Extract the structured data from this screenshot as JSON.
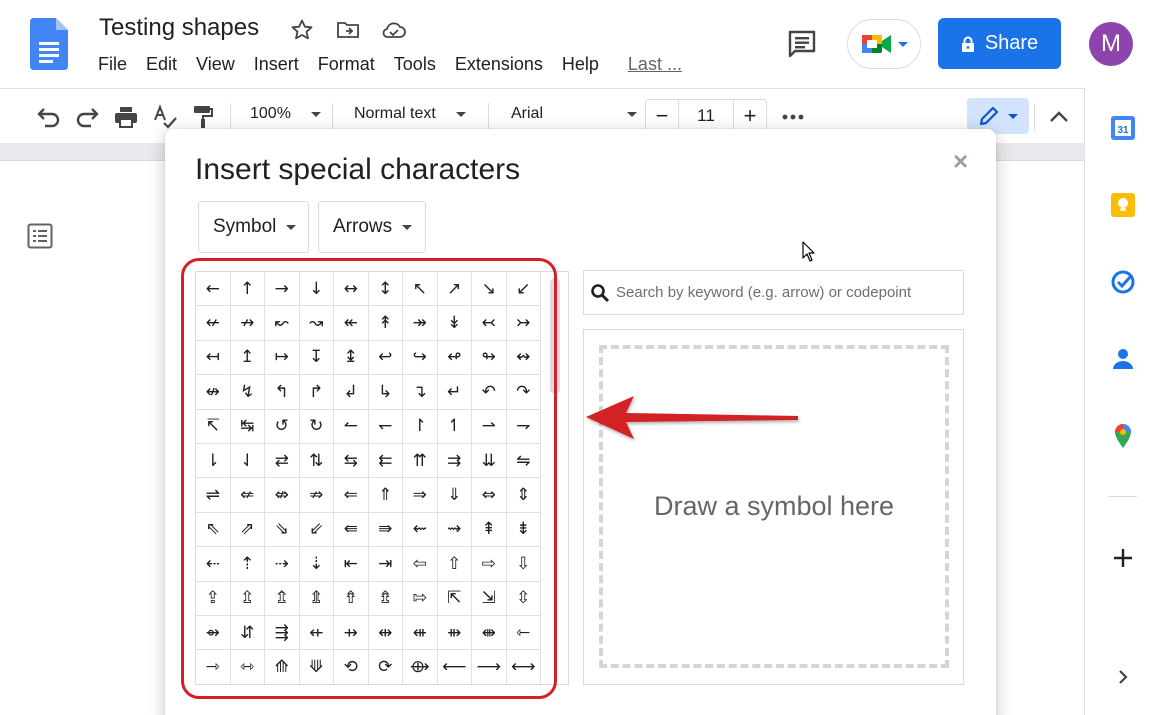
{
  "doc": {
    "title": "Testing shapes",
    "menus": [
      "File",
      "Edit",
      "View",
      "Insert",
      "Format",
      "Tools",
      "Extensions",
      "Help"
    ],
    "last_edit": "Last ..."
  },
  "header": {
    "share_label": "Share",
    "avatar_initial": "M"
  },
  "toolbar": {
    "zoom": "100%",
    "style": "Normal text",
    "font": "Arial",
    "font_size": "11",
    "minus": "−",
    "plus": "+"
  },
  "dialog": {
    "title": "Insert special characters",
    "close": "×",
    "category": "Symbol",
    "subcategory": "Arrows",
    "search_placeholder": "Search by keyword (e.g. arrow) or codepoint",
    "draw_hint": "Draw a symbol here",
    "symbols": [
      [
        "←",
        "↑",
        "→",
        "↓",
        "↔",
        "↕",
        "↖",
        "↗",
        "↘",
        "↙"
      ],
      [
        "↚",
        "↛",
        "↜",
        "↝",
        "↞",
        "↟",
        "↠",
        "↡",
        "↢",
        "↣"
      ],
      [
        "↤",
        "↥",
        "↦",
        "↧",
        "↨",
        "↩",
        "↪",
        "↫",
        "↬",
        "↭"
      ],
      [
        "↮",
        "↯",
        "↰",
        "↱",
        "↲",
        "↳",
        "↴",
        "↵",
        "↶",
        "↷"
      ],
      [
        "↸",
        "↹",
        "↺",
        "↻",
        "↼",
        "↽",
        "↾",
        "↿",
        "⇀",
        "⇁"
      ],
      [
        "⇂",
        "⇃",
        "⇄",
        "⇅",
        "⇆",
        "⇇",
        "⇈",
        "⇉",
        "⇊",
        "⇋"
      ],
      [
        "⇌",
        "⇍",
        "⇎",
        "⇏",
        "⇐",
        "⇑",
        "⇒",
        "⇓",
        "⇔",
        "⇕"
      ],
      [
        "⇖",
        "⇗",
        "⇘",
        "⇙",
        "⇚",
        "⇛",
        "⇜",
        "⇝",
        "⇞",
        "⇟"
      ],
      [
        "⇠",
        "⇡",
        "⇢",
        "⇣",
        "⇤",
        "⇥",
        "⇦",
        "⇧",
        "⇨",
        "⇩"
      ],
      [
        "⇪",
        "⇫",
        "⇬",
        "⇭",
        "⇮",
        "⇯",
        "⇰",
        "⇱",
        "⇲",
        "⇳"
      ],
      [
        "⇴",
        "⇵",
        "⇶",
        "⇷",
        "⇸",
        "⇹",
        "⇺",
        "⇻",
        "⇼",
        "⇽"
      ],
      [
        "⇾",
        "⇿",
        "⟰",
        "⟱",
        "⟲",
        "⟳",
        "⟴",
        "⟵",
        "⟶",
        "⟷"
      ]
    ]
  },
  "side_panel": {
    "calendar_day": "31",
    "apps": [
      "calendar-icon",
      "keep-icon",
      "tasks-icon",
      "contacts-icon",
      "maps-icon",
      "add-icon",
      "expand-icon"
    ]
  },
  "colors": {
    "brand_blue": "#1a73e8",
    "highlight_red": "#d32027",
    "avatar_purple": "#8e44ad"
  }
}
